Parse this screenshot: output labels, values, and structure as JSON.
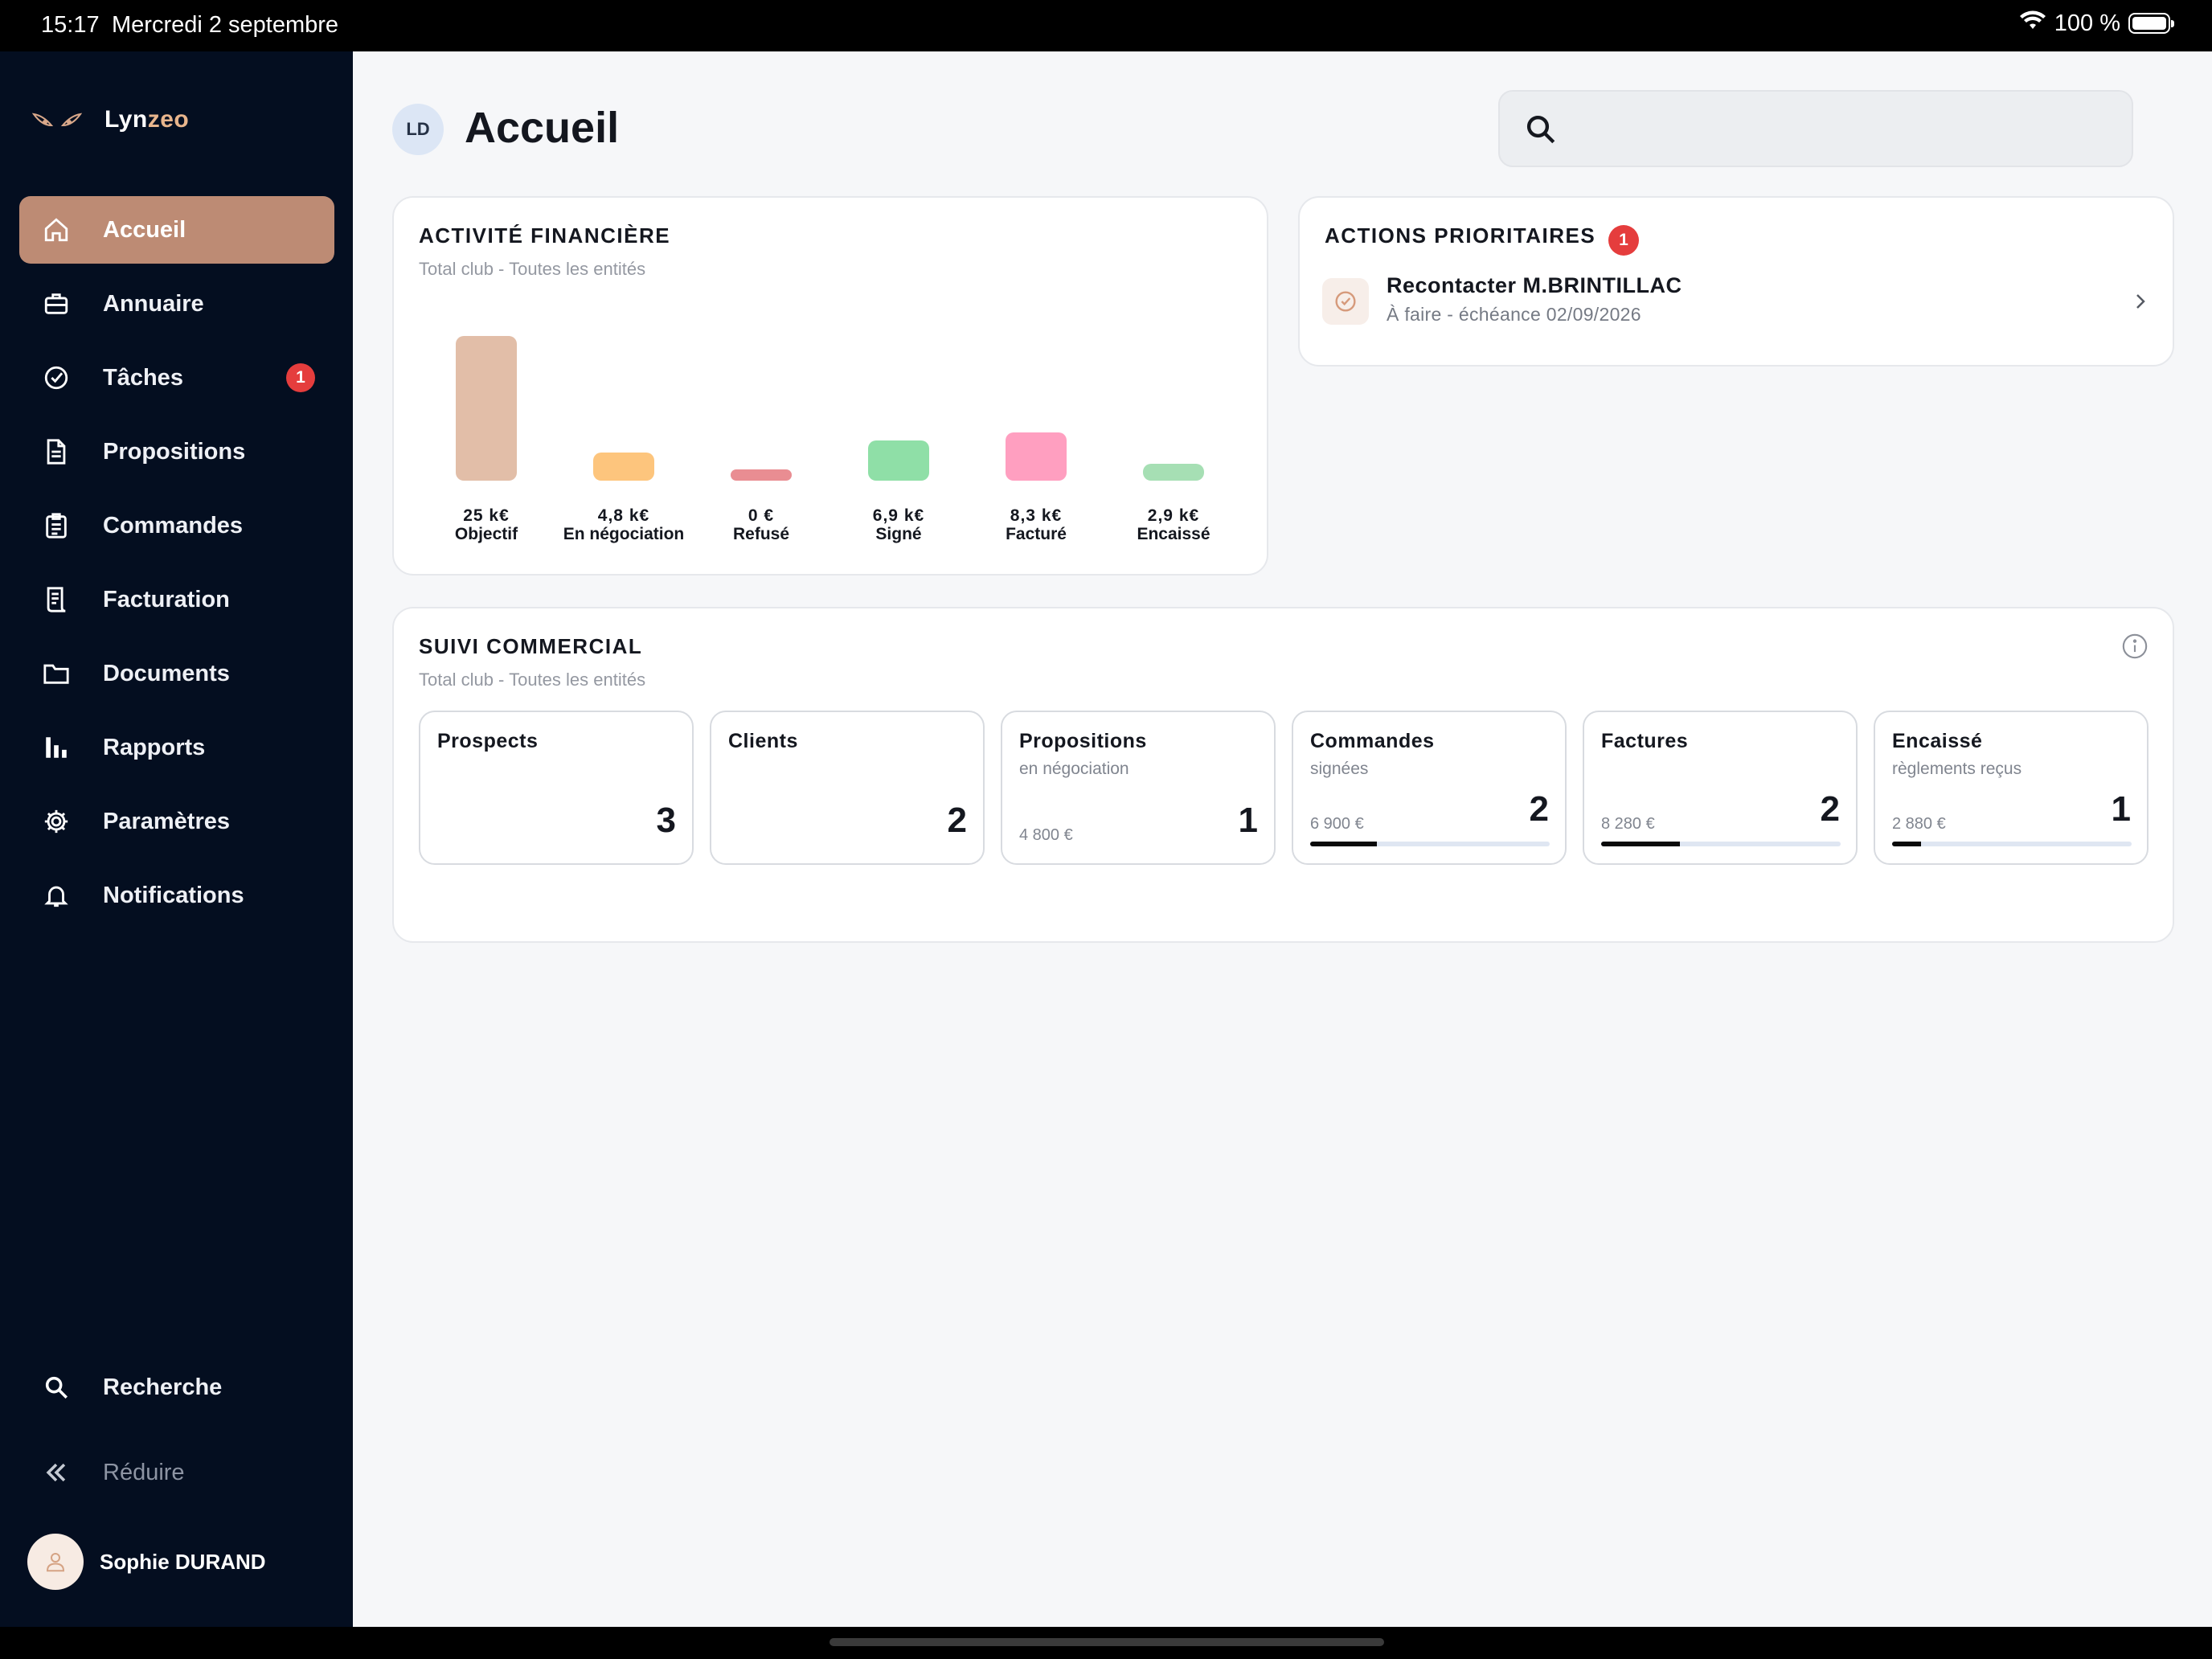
{
  "status_bar": {
    "time": "15:17",
    "date": "Mercredi 2 septembre",
    "battery": "100 %"
  },
  "brand": {
    "part1": "Lyn",
    "part2": "zeo"
  },
  "sidebar": {
    "items": [
      {
        "label": "Accueil",
        "icon": "home-icon",
        "active": true
      },
      {
        "label": "Annuaire",
        "icon": "briefcase-icon"
      },
      {
        "label": "Tâches",
        "icon": "check-circle-icon",
        "badge": "1"
      },
      {
        "label": "Propositions",
        "icon": "document-icon"
      },
      {
        "label": "Commandes",
        "icon": "clipboard-icon"
      },
      {
        "label": "Facturation",
        "icon": "receipt-icon"
      },
      {
        "label": "Documents",
        "icon": "folder-icon"
      },
      {
        "label": "Rapports",
        "icon": "bar-chart-icon"
      },
      {
        "label": "Paramètres",
        "icon": "gear-icon"
      },
      {
        "label": "Notifications",
        "icon": "bell-icon"
      }
    ],
    "search_label": "Recherche",
    "collapse_label": "Réduire",
    "user_name": "Sophie DURAND"
  },
  "header": {
    "initials": "LD",
    "title": "Accueil"
  },
  "search": {
    "placeholder": ""
  },
  "financial": {
    "title": "ACTIVITÉ FINANCIÈRE",
    "subtitle": "Total club - Toutes les entités"
  },
  "chart_data": {
    "type": "bar",
    "categories": [
      "Objectif",
      "En négociation",
      "Refusé",
      "Signé",
      "Facturé",
      "Encaissé"
    ],
    "values": [
      25,
      4.8,
      0,
      6.9,
      8.3,
      2.9
    ],
    "value_labels": [
      "25 k€",
      "4,8 k€",
      "0 €",
      "6,9 k€",
      "8,3 k€",
      "2,9 k€"
    ],
    "unit": "k€",
    "colors": [
      "#e2bea8",
      "#fdc57d",
      "#e98d92",
      "#8fdfa7",
      "#ff9fc0",
      "#a6dfb4"
    ],
    "title": "ACTIVITÉ FINANCIÈRE",
    "subtitle": "Total club - Toutes les entités"
  },
  "actions": {
    "title": "ACTIONS PRIORITAIRES",
    "count": "1",
    "items": [
      {
        "title": "Recontacter M.BRINTILLAC",
        "subtitle": "À faire - échéance 02/09/2026"
      }
    ]
  },
  "suivi": {
    "title": "SUIVI COMMERCIAL",
    "subtitle": "Total club - Toutes les entités",
    "tiles": [
      {
        "title": "Prospects",
        "sub": "",
        "count": "3",
        "amount": ""
      },
      {
        "title": "Clients",
        "sub": "",
        "count": "2",
        "amount": ""
      },
      {
        "title": "Propositions",
        "sub": "en négociation",
        "count": "1",
        "amount": "4 800 €"
      },
      {
        "title": "Commandes",
        "sub": "signées",
        "count": "2",
        "amount": "6 900 €",
        "progress": 0.28
      },
      {
        "title": "Factures",
        "sub": "",
        "count": "2",
        "amount": "8 280 €",
        "progress": 0.33
      },
      {
        "title": "Encaissé",
        "sub": "règlements reçus",
        "count": "1",
        "amount": "2 880 €",
        "progress": 0.12
      }
    ]
  }
}
